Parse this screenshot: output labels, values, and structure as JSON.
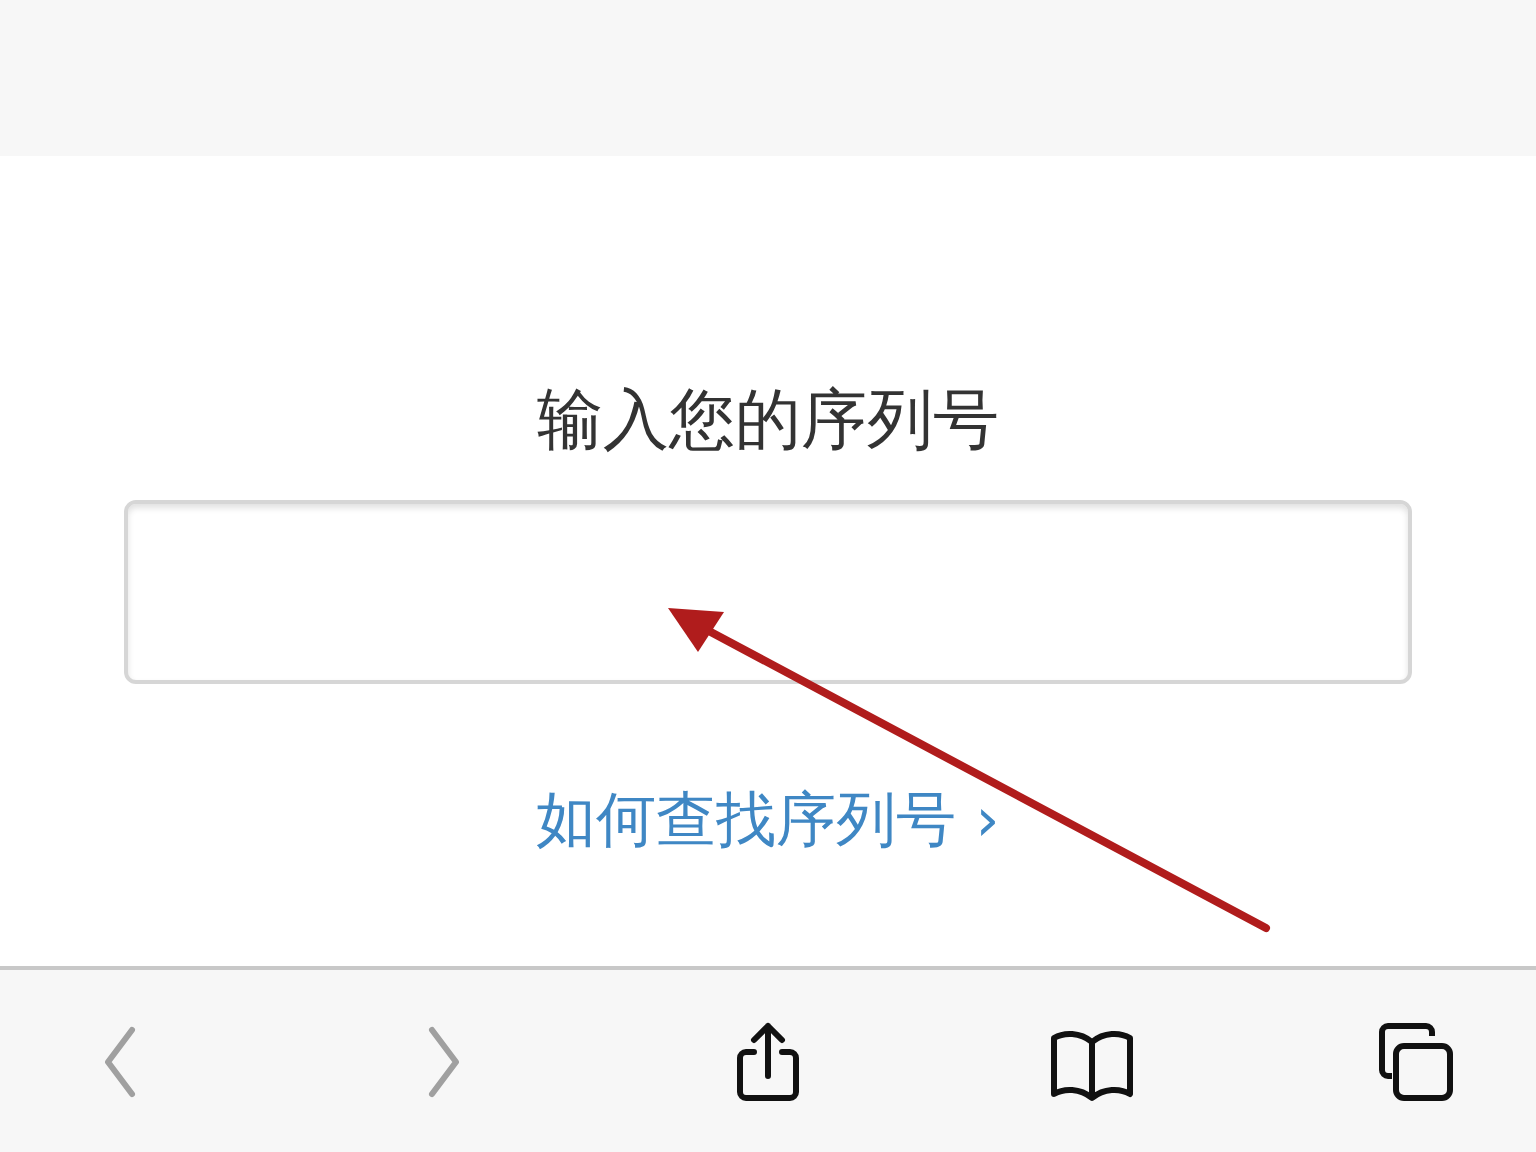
{
  "heading": "输入您的序列号",
  "help_link": "如何查找序列号 ›",
  "toolbar": [
    {
      "kind": "back",
      "disabled": true
    },
    {
      "kind": "forward",
      "disabled": true
    },
    {
      "kind": "share",
      "disabled": false
    },
    {
      "kind": "bookmarks",
      "disabled": false
    },
    {
      "kind": "tabs",
      "disabled": false
    }
  ]
}
